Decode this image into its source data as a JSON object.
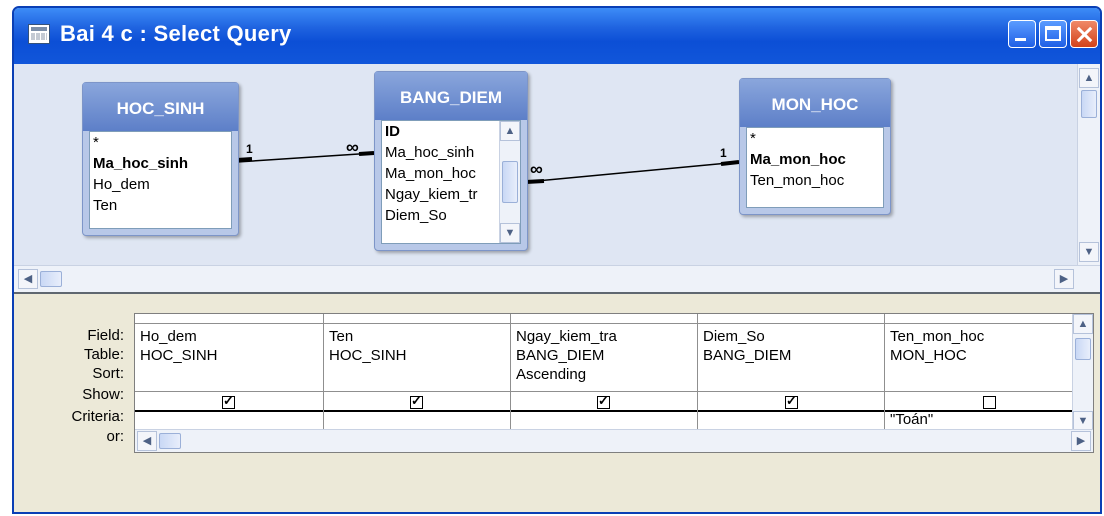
{
  "window": {
    "title": "Bai 4 c : Select Query"
  },
  "tables": [
    {
      "name": "HOC_SINH",
      "fields": [
        {
          "label": "*",
          "key": false
        },
        {
          "label": "Ma_hoc_sinh",
          "key": true
        },
        {
          "label": "Ho_dem",
          "key": false
        },
        {
          "label": "Ten",
          "key": false
        }
      ]
    },
    {
      "name": "BANG_DIEM",
      "fields": [
        {
          "label": "ID",
          "key": true
        },
        {
          "label": "Ma_hoc_sinh",
          "key": false
        },
        {
          "label": "Ma_mon_hoc",
          "key": false
        },
        {
          "label": "Ngay_kiem_tr",
          "key": false
        },
        {
          "label": "Diem_So",
          "key": false
        }
      ]
    },
    {
      "name": "MON_HOC",
      "fields": [
        {
          "label": "*",
          "key": false
        },
        {
          "label": "Ma_mon_hoc",
          "key": true
        },
        {
          "label": "Ten_mon_hoc",
          "key": false
        }
      ]
    }
  ],
  "relationships": [
    {
      "one_label": "1",
      "many_label": "∞"
    },
    {
      "one_label": "1",
      "many_label": "∞"
    }
  ],
  "grid": {
    "row_labels": [
      "Field:",
      "Table:",
      "Sort:",
      "Show:",
      "Criteria:",
      "or:"
    ],
    "columns": [
      {
        "field": "Ho_dem",
        "table": "HOC_SINH",
        "sort": "",
        "show": true,
        "criteria": ""
      },
      {
        "field": "Ten",
        "table": "HOC_SINH",
        "sort": "",
        "show": true,
        "criteria": ""
      },
      {
        "field": "Ngay_kiem_tra",
        "table": "BANG_DIEM",
        "sort": "Ascending",
        "show": true,
        "criteria": ""
      },
      {
        "field": "Diem_So",
        "table": "BANG_DIEM",
        "sort": "",
        "show": true,
        "criteria": ""
      },
      {
        "field": "Ten_mon_hoc",
        "table": "MON_HOC",
        "sort": "",
        "show": false,
        "criteria": "\"Toán\""
      }
    ]
  }
}
